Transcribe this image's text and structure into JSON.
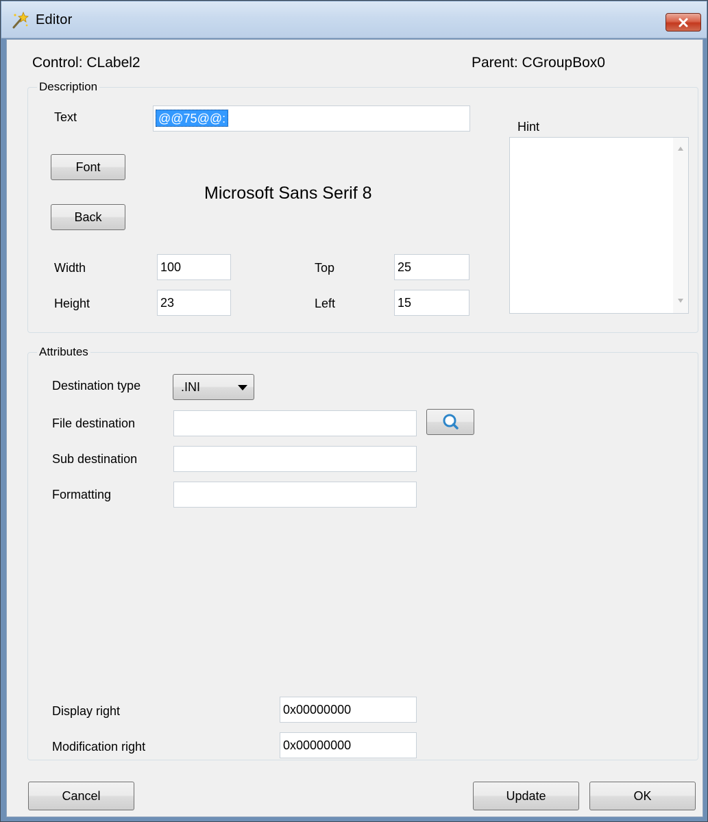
{
  "window": {
    "title": "Editor",
    "colors": {
      "titlebar": "#c9daee",
      "close_button": "#c4391f",
      "client_bg": "#f0f0f0",
      "selection": "#3399ff"
    }
  },
  "header": {
    "control_label": "Control: CLabel2",
    "parent_label": "Parent: CGroupBox0"
  },
  "description": {
    "legend": "Description",
    "text_label": "Text",
    "text_value": "@@75@@:",
    "hint_label": "Hint",
    "hint_value": "",
    "font_button": "Font",
    "back_button": "Back",
    "font_preview": "Microsoft Sans Serif 8",
    "width_label": "Width",
    "width_value": "100",
    "height_label": "Height",
    "height_value": "23",
    "top_label": "Top",
    "top_value": "25",
    "left_label": "Left",
    "left_value": "15"
  },
  "attributes": {
    "legend": "Attributes",
    "destination_type_label": "Destination type",
    "destination_type_value": ".INI",
    "file_destination_label": "File destination",
    "file_destination_value": "",
    "sub_destination_label": "Sub destination",
    "sub_destination_value": "",
    "formatting_label": "Formatting",
    "formatting_value": "",
    "display_right_label": "Display right",
    "display_right_value": "0x00000000",
    "modification_right_label": "Modification right",
    "modification_right_value": "0x00000000"
  },
  "buttons": {
    "cancel": "Cancel",
    "update": "Update",
    "ok": "OK"
  },
  "icons": {
    "app": "editor-wand-icon",
    "close": "close-icon",
    "browse": "magnifier-icon",
    "dropdown": "dropdown-arrow-icon"
  }
}
